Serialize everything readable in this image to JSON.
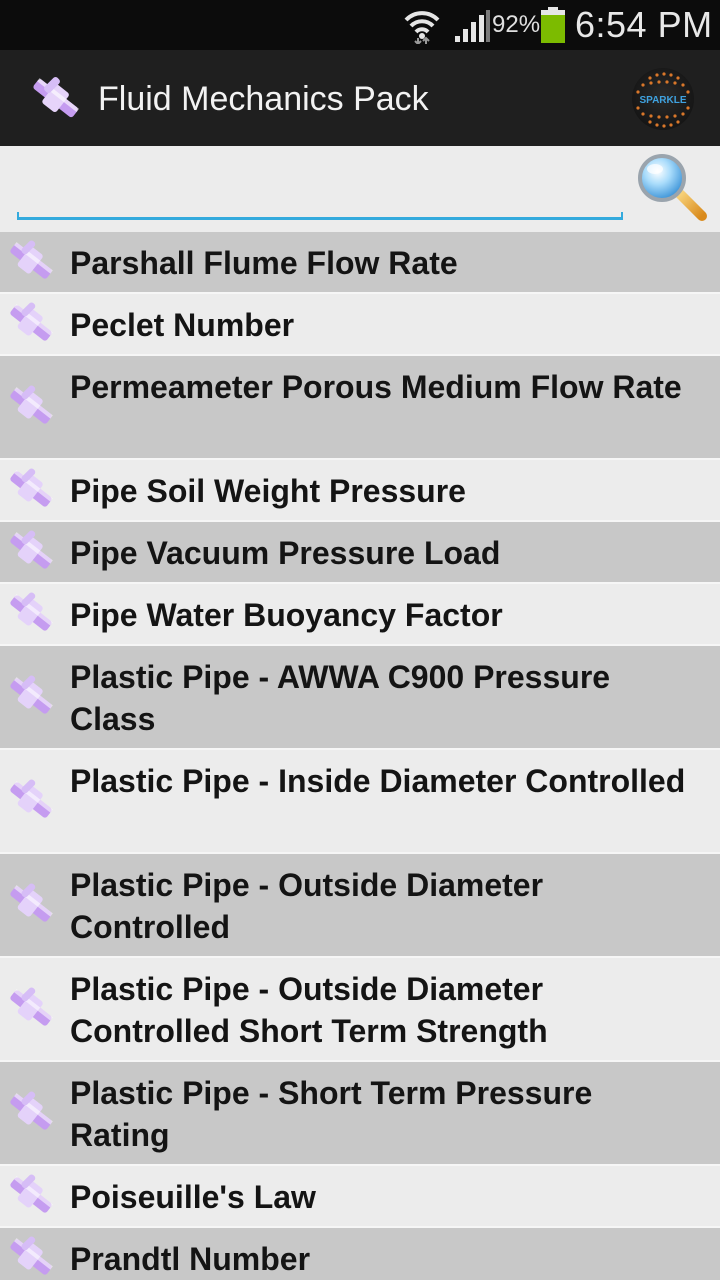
{
  "status_bar": {
    "battery_percent": "92%",
    "time": "6:54 PM",
    "battery_color": "#7cbb00",
    "icons": [
      "wifi-icon",
      "signal-icon",
      "battery-icon"
    ]
  },
  "action_bar": {
    "title": "Fluid Mechanics Pack",
    "brand_logo_text": "SPARKLE",
    "app_icon": "pipe-icon",
    "background": "#1f1f1f"
  },
  "search": {
    "placeholder": "",
    "value": "",
    "icon": "magnifier-icon",
    "accent": "#33aadd"
  },
  "list": {
    "item_icon": "pipe-icon",
    "item_icon_color": "#c59cf0",
    "items": [
      {
        "label": "Parshall Flume Flow Rate"
      },
      {
        "label": "Peclet Number"
      },
      {
        "label": "Permeameter Porous Medium Flow Rate"
      },
      {
        "label": "Pipe Soil Weight Pressure"
      },
      {
        "label": "Pipe Vacuum Pressure Load"
      },
      {
        "label": "Pipe Water Buoyancy Factor"
      },
      {
        "label": "Plastic Pipe - AWWA C900 Pressure Class"
      },
      {
        "label": "Plastic Pipe - Inside Diameter Controlled"
      },
      {
        "label": "Plastic Pipe - Outside Diameter Controlled"
      },
      {
        "label": "Plastic Pipe - Outside Diameter Controlled Short Term Strength"
      },
      {
        "label": "Plastic Pipe - Short Term Pressure Rating"
      },
      {
        "label": "Poiseuille's Law"
      },
      {
        "label": "Prandtl Number"
      }
    ]
  }
}
